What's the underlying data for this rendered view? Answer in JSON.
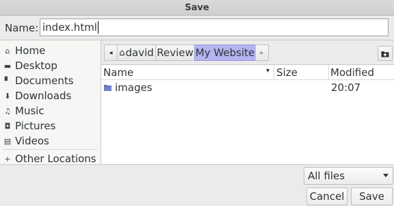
{
  "window": {
    "title": "Save"
  },
  "name_field": {
    "label": "Name:",
    "value": "index.html"
  },
  "sidebar": {
    "items": [
      {
        "label": "Home",
        "icon": "home-icon",
        "glyph": "⌂"
      },
      {
        "label": "Desktop",
        "icon": "desktop-icon",
        "glyph": "▬"
      },
      {
        "label": "Documents",
        "icon": "document-icon",
        "glyph": "▘"
      },
      {
        "label": "Downloads",
        "icon": "download-icon",
        "glyph": "⬇"
      },
      {
        "label": "Music",
        "icon": "music-icon",
        "glyph": "♫"
      },
      {
        "label": "Pictures",
        "icon": "camera-icon",
        "glyph": "◘"
      },
      {
        "label": "Videos",
        "icon": "film-icon",
        "glyph": "▤"
      }
    ],
    "other_locations": {
      "label": "Other Locations",
      "icon": "plus-icon",
      "glyph": "+"
    }
  },
  "pathbar": {
    "back_glyph": "◂",
    "forward_glyph": "▸",
    "home_glyph": "⌂",
    "segments": [
      {
        "label": "david",
        "active": false
      },
      {
        "label": "Review",
        "active": false
      },
      {
        "label": "My Website",
        "active": true
      }
    ],
    "new_folder_icon": "new-folder-icon"
  },
  "file_list": {
    "columns": {
      "name": "Name",
      "size": "Size",
      "modified": "Modified"
    },
    "sort_glyph": "▾",
    "rows": [
      {
        "name": "images",
        "size": "",
        "modified": "20:07",
        "icon": "folder-icon"
      }
    ]
  },
  "filter": {
    "selected": "All files"
  },
  "buttons": {
    "cancel": "Cancel",
    "save": "Save"
  },
  "colors": {
    "active_segment": "#b4b4f0",
    "folder": "#5a6fb5"
  }
}
